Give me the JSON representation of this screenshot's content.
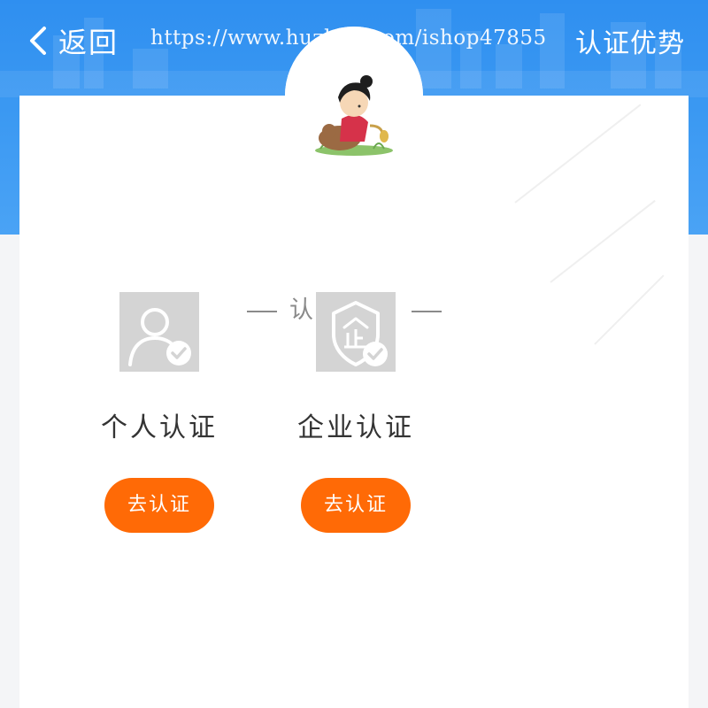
{
  "header": {
    "back_label": "返回",
    "title": "认证优势",
    "watermark": "https://www.huzhan.com/ishop47855",
    "back_icon": "chevron-left-icon"
  },
  "colors": {
    "header_blue": "#3a98f2",
    "accent_orange": "#ff6a06",
    "icon_gray": "#d4d4d4"
  },
  "section": {
    "title": "认证中心"
  },
  "certifications": [
    {
      "label": "个人认证",
      "button_label": "去认证",
      "icon": "person-verified-icon"
    },
    {
      "label": "企业认证",
      "button_label": "去认证",
      "icon": "enterprise-shield-verified-icon"
    }
  ]
}
